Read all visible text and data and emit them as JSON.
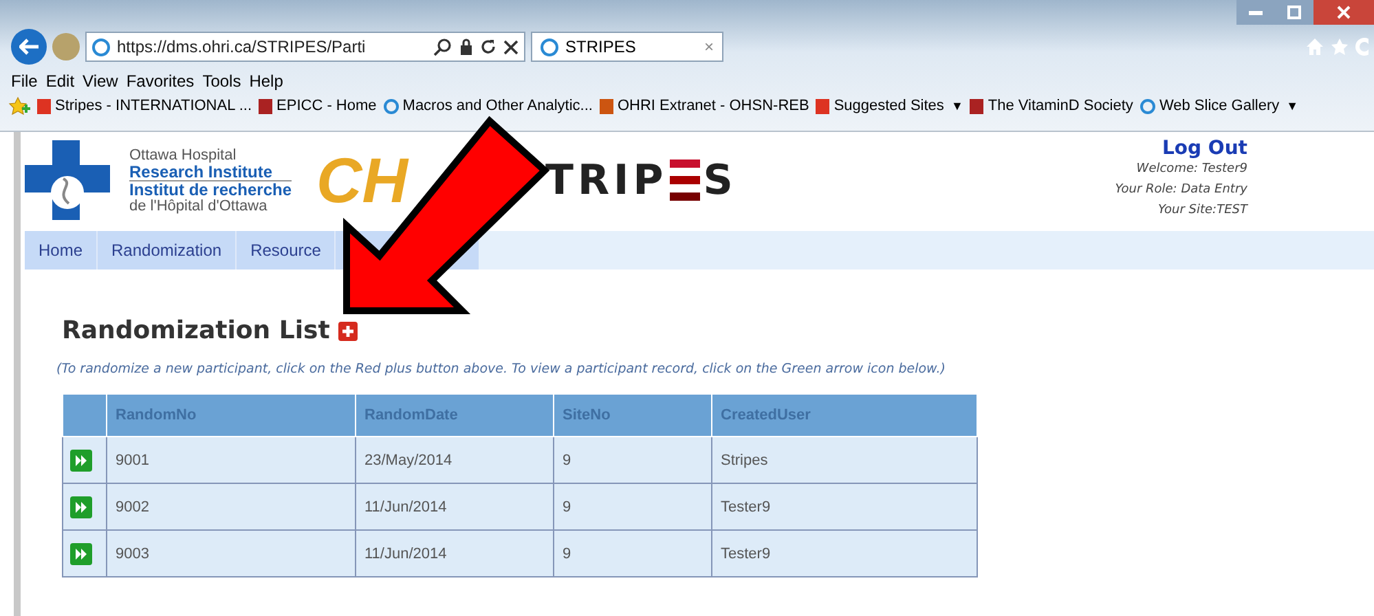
{
  "browser": {
    "address": "https://dms.ohri.ca/STRIPES/Parti",
    "tab": {
      "title": "STRIPES",
      "close": "×"
    },
    "menu": [
      "File",
      "Edit",
      "View",
      "Favorites",
      "Tools",
      "Help"
    ],
    "favorites": [
      {
        "label": "Stripes - INTERNATIONAL ..."
      },
      {
        "label": "EPICC - Home"
      },
      {
        "label": "Macros and Other Analytic..."
      },
      {
        "label": "OHRI Extranet - OHSN-REB"
      },
      {
        "label": "Suggested Sites",
        "menu_arrow": "▼"
      },
      {
        "label": "The VitaminD Society"
      },
      {
        "label": "Web Slice Gallery",
        "menu_arrow": "▼"
      }
    ]
  },
  "header": {
    "ohri_logo": [
      "Ottawa Hospital",
      "Research Institute",
      "Institut de recherche",
      "de l'Hôpital d'Ottawa"
    ],
    "partner_logo": "CH",
    "stripes_logo": {
      "before": "TRIP",
      "after": "S"
    },
    "logout": "Log Out",
    "welcome": "Welcome: Tester9",
    "role": "Your Role: Data Entry",
    "site": "Your Site:TEST"
  },
  "nav": [
    {
      "label": "Home"
    },
    {
      "label": "Randomization"
    },
    {
      "label": "Resource"
    }
  ],
  "title": "Randomization List",
  "note": "(To randomize a new participant, click on the Red plus button above. To view a participant record, click on the Green arrow icon below.)",
  "table": {
    "columns": [
      "RandomNo",
      "RandomDate",
      "SiteNo",
      "CreatedUser"
    ],
    "rows": [
      [
        "9001",
        "23/May/2014",
        "9",
        "Stripes"
      ],
      [
        "9002",
        "11/Jun/2014",
        "9",
        "Tester9"
      ],
      [
        "9003",
        "11/Jun/2014",
        "9",
        "Tester9"
      ]
    ]
  }
}
